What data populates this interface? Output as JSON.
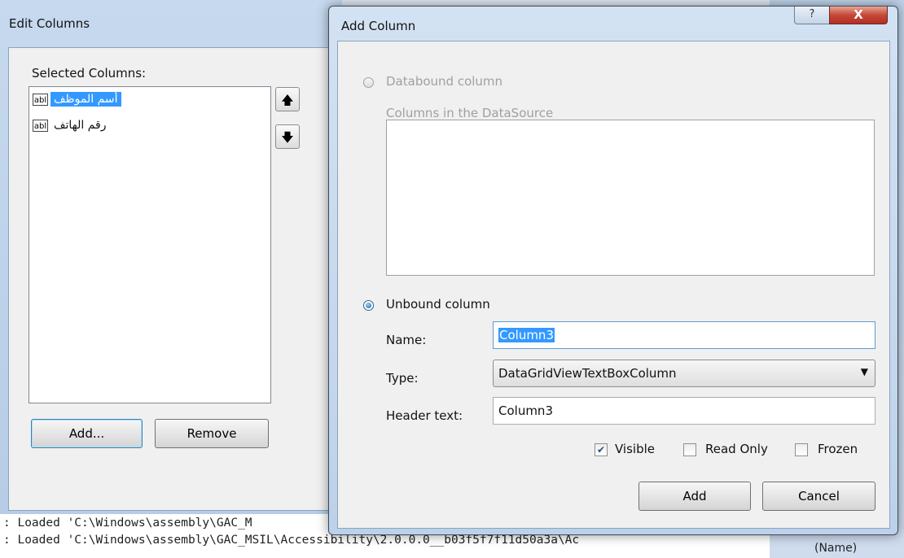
{
  "edit_columns": {
    "title": "Edit Columns",
    "selected_label": "Selected Columns:",
    "columns": [
      {
        "type_icon": "abl",
        "text": "أسم الموظف",
        "selected": true
      },
      {
        "type_icon": "abl",
        "text": "رقم الهاتف",
        "selected": false
      }
    ],
    "move_up_glyph": "🡅",
    "move_down_glyph": "🡇",
    "add_label": "Add...",
    "remove_label": "Remove"
  },
  "output": {
    "line1": ": Loaded 'C:\\Windows\\assembly\\GAC_M",
    "line2": ": Loaded 'C:\\Windows\\assembly\\GAC_MSIL\\Accessibility\\2.0.0.0__b03f5f7f11d50a3a\\Ac"
  },
  "properties": {
    "name_label": "(Name)"
  },
  "add_column": {
    "title": "Add Column",
    "help_glyph": "?",
    "close_glyph": "X",
    "databound_label": "Databound column",
    "datasource_label": "Columns in the DataSource",
    "unbound_label": "Unbound column",
    "name_label": "Name:",
    "name_value": "Column3",
    "type_label": "Type:",
    "type_value": "DataGridViewTextBoxColumn",
    "header_label": "Header text:",
    "header_value": "Column3",
    "visible_label": "Visible",
    "visible_checked": true,
    "readonly_label": "Read Only",
    "readonly_checked": false,
    "frozen_label": "Frozen",
    "frozen_checked": false,
    "add_label": "Add",
    "cancel_label": "Cancel"
  }
}
